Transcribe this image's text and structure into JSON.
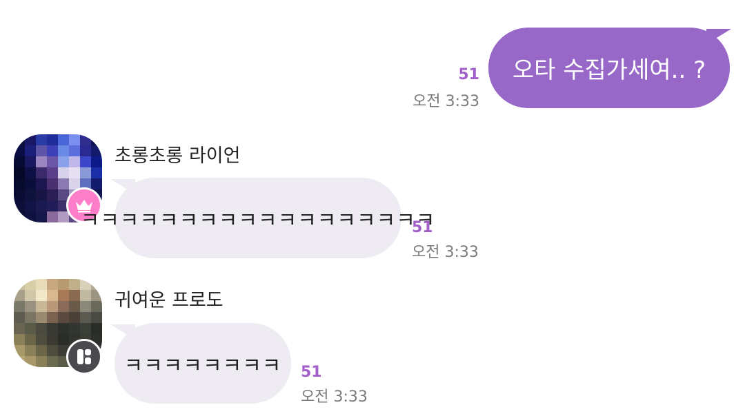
{
  "messages": {
    "outgoing": {
      "text": "오타 수집가세여.. ?",
      "unread": "51",
      "time": "오전 3:33",
      "bubble_color": "#9868c8"
    },
    "incoming_1": {
      "sender": "초롱초롱 라이언",
      "text": "ㅋㅋㅋㅋㅋㅋㅋㅋㅋㅋㅋㅋㅋㅋㅋㅋㅋㅋ",
      "unread": "51",
      "time": "오전 3:33",
      "badge_icon": "crown-icon",
      "badge_color": "#ff7eca"
    },
    "incoming_2": {
      "sender": "귀여운 프로도",
      "text": "ㅋㅋㅋㅋㅋㅋㅋㅋ",
      "unread": "51",
      "time": "오전 3:33",
      "badge_icon": "profile-card-icon",
      "badge_color": "#4a4a4e"
    }
  },
  "colors": {
    "unread_accent": "#a25fc9",
    "incoming_bubble": "#eeecf2",
    "time_text": "#7a7a7a"
  }
}
